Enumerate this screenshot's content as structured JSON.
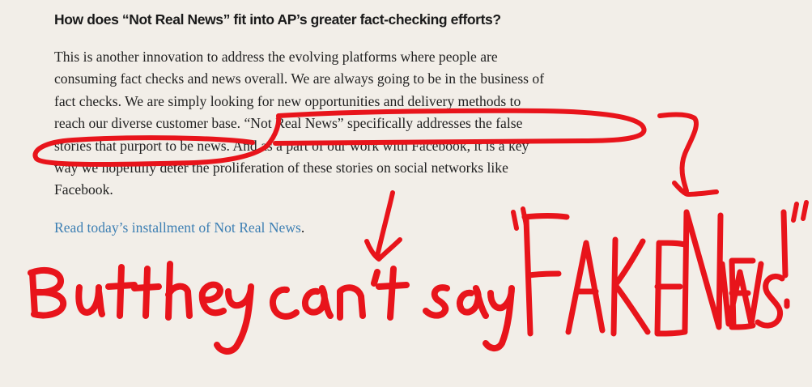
{
  "article": {
    "heading": "How does “Not Real News” fit into AP’s greater fact-checking efforts?",
    "paragraph_lines": [
      "This is another innovation to address the evolving platforms where people are",
      "consuming fact checks and news overall. We are always going to be in the business of",
      "fact checks. We are simply looking for new opportunities and delivery methods to",
      "reach our diverse customer base. “Not Real News” specifically addresses the false",
      "stories that purport to be news. And as a part of our work with Facebook, it is a key",
      "way we hopefully deter the proliferation of these stories on social networks like",
      "Facebook."
    ],
    "link_text": "Read today’s installment of Not Real News",
    "link_suffix": "."
  },
  "annotation": {
    "ink_color": "#e8141b"
  }
}
